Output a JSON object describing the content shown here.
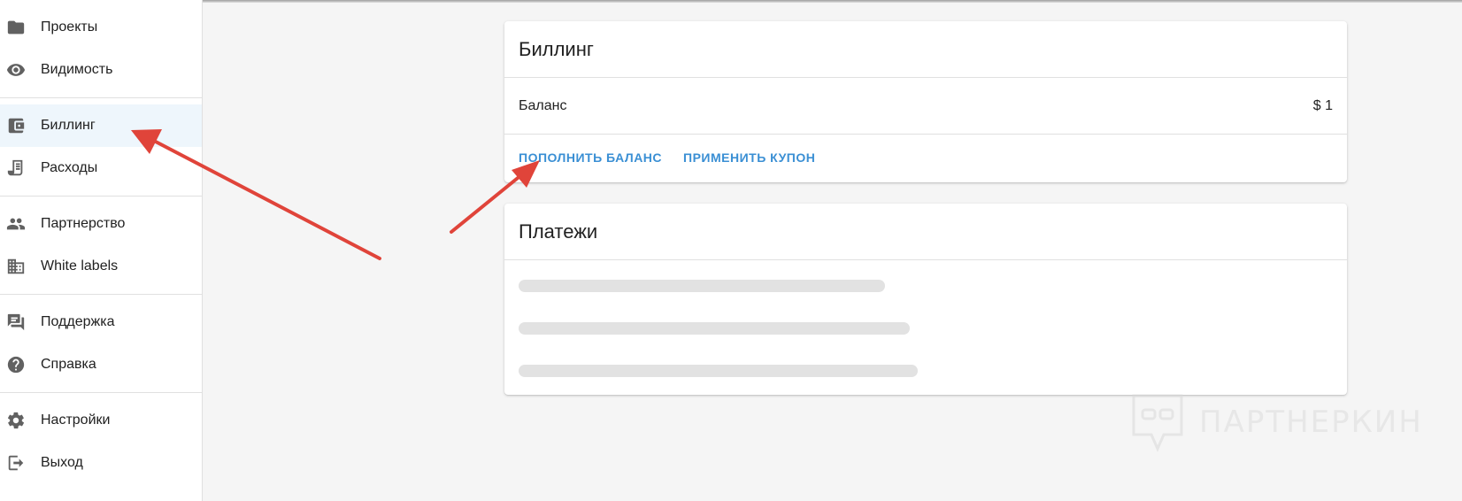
{
  "sidebar": {
    "items": [
      {
        "label": "Проекты",
        "icon": "folder-icon"
      },
      {
        "label": "Видимость",
        "icon": "eye-icon"
      },
      {
        "label": "Биллинг",
        "icon": "wallet-icon",
        "active": true
      },
      {
        "label": "Расходы",
        "icon": "receipt-icon"
      },
      {
        "label": "Партнерство",
        "icon": "people-icon"
      },
      {
        "label": "White labels",
        "icon": "building-icon"
      },
      {
        "label": "Поддержка",
        "icon": "chat-icon"
      },
      {
        "label": "Справка",
        "icon": "help-icon"
      },
      {
        "label": "Настройки",
        "icon": "gear-icon"
      },
      {
        "label": "Выход",
        "icon": "exit-icon"
      }
    ]
  },
  "billing": {
    "title": "Биллинг",
    "balance_label": "Баланс",
    "balance_value": "$ 1",
    "topup_label": "ПОПОЛНИТЬ БАЛАНС",
    "coupon_label": "ПРИМЕНИТЬ КУПОН"
  },
  "payments": {
    "title": "Платежи"
  },
  "watermark": {
    "text": "ПАРТНЕРКИН"
  },
  "colors": {
    "accent": "#3a8fd4",
    "active_bg": "#eef6fc",
    "arrow": "#e0443a"
  }
}
